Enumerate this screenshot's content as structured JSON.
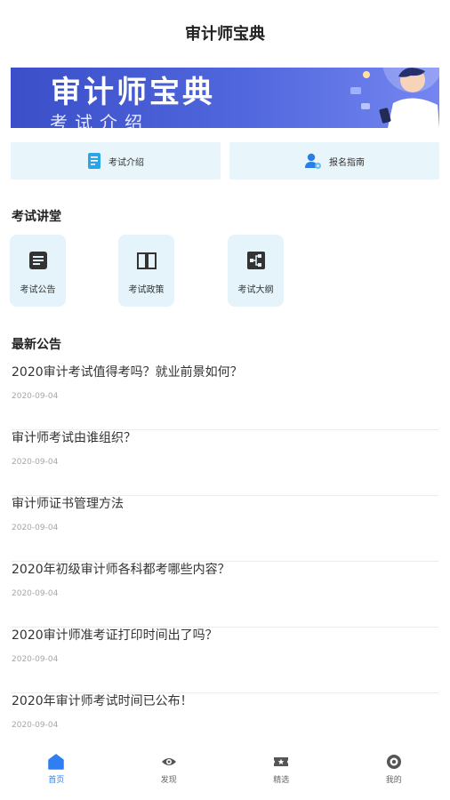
{
  "header": {
    "title": "审计师宝典"
  },
  "banner": {
    "title": "审计师宝典",
    "subtitle": "考试介绍"
  },
  "quick_links": [
    {
      "label": "考试介绍",
      "icon": "document-icon"
    },
    {
      "label": "报名指南",
      "icon": "user-settings-icon"
    }
  ],
  "lecture": {
    "title": "考试讲堂",
    "items": [
      {
        "label": "考试公告",
        "icon": "list-icon"
      },
      {
        "label": "考试政策",
        "icon": "book-icon"
      },
      {
        "label": "考试大纲",
        "icon": "outline-icon"
      }
    ]
  },
  "news": {
    "title": "最新公告",
    "items": [
      {
        "title": "2020审计考试值得考吗？就业前景如何？",
        "date": "2020-09-04"
      },
      {
        "title": "审计师考试由谁组织？",
        "date": "2020-09-04"
      },
      {
        "title": "审计师证书管理方法",
        "date": "2020-09-04"
      },
      {
        "title": "2020年初级审计师各科都考哪些内容？",
        "date": "2020-09-04"
      },
      {
        "title": "2020审计师准考证打印时间出了吗？",
        "date": "2020-09-04"
      },
      {
        "title": "2020年审计师考试时间已公布！",
        "date": "2020-09-04"
      }
    ]
  },
  "tabbar": [
    {
      "label": "首页",
      "icon": "home-icon",
      "active": true
    },
    {
      "label": "发现",
      "icon": "eye-icon",
      "active": false
    },
    {
      "label": "精选",
      "icon": "ticket-star-icon",
      "active": false
    },
    {
      "label": "我的",
      "icon": "profile-icon",
      "active": false
    }
  ],
  "colors": {
    "accent": "#2f7ff2",
    "tile_bg": "#e4f4fa",
    "banner": "#4a5fd6"
  }
}
